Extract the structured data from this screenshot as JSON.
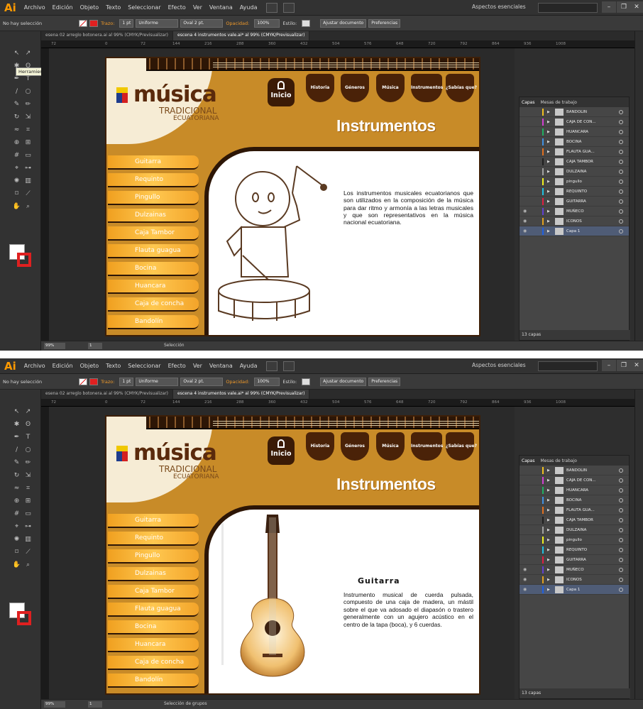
{
  "app": {
    "logo": "Ai",
    "workspace": "Aspectos esenciales"
  },
  "menu": [
    "Archivo",
    "Edición",
    "Objeto",
    "Texto",
    "Seleccionar",
    "Efecto",
    "Ver",
    "Ventana",
    "Ayuda"
  ],
  "control_bar": {
    "selection_state": "No hay selección",
    "stroke_label": "Trazo:",
    "stroke_weight": "1 pt",
    "profile": "Uniforme",
    "brush": "Oval 2 pt.",
    "opacity_label": "Opacidad:",
    "opacity_value": "100%",
    "style_label": "Estilo:",
    "fit_doc": "Ajustar documento",
    "prefs": "Preferencias"
  },
  "doc_tabs": [
    {
      "label": "esena 02 arreglo botonera.ai al 99% (CMYK/Previsualizar)"
    },
    {
      "label": "escena 4 instrumentos vale.ai* al 99% (CMYK/Previsualizar)"
    }
  ],
  "ruler_ticks": [
    "72",
    "0",
    "72",
    "144",
    "216",
    "288",
    "360",
    "432",
    "504",
    "576",
    "648",
    "720",
    "792",
    "864",
    "936",
    "1008",
    "1080"
  ],
  "tooltip": "Herramienta Selección (V)",
  "artboard": {
    "logo_main": "música",
    "logo_sub1": "TRADICIONAL",
    "logo_sub2": "ECUATORIANA",
    "home_label": "Inicio",
    "nav": [
      "Historia",
      "Géneros",
      "Música",
      "Instrumentos",
      "¿Sabías que?"
    ],
    "section_title": "Instrumentos",
    "sidebar": [
      "Guitarra",
      "Requinto",
      "Pingullo",
      "Dulzainas",
      "Caja Tambor",
      "Flauta guagua",
      "Bocina",
      "Huancara",
      "Caja de concha",
      "Bandolín"
    ]
  },
  "screen1": {
    "body": "Los instrumentos musicales ecuatorianos que son utilizados en la composición de la música para dar ritmo y armonía a las letras musicales y que son representativos en la música nacional ecuatoriana.",
    "zoom": "99%",
    "page": "1",
    "status": "Selección"
  },
  "screen2": {
    "heading": "Guitarra",
    "body": "Instrumento musical de cuerda pulsada, compuesto de una caja de madera, un mástil sobre el que va adosado el diapasón o trastero generalmente con un agujero acústico en el centro de la tapa (boca), y 6 cuerdas.",
    "zoom": "99%",
    "page": "1",
    "status": "Selección de grupos"
  },
  "layers_panel": {
    "tabs": [
      "Capas",
      "Mesas de trabajo"
    ],
    "count": "13 capas",
    "layers": [
      {
        "name": "BANDOLIN",
        "color": "#f0c020",
        "eye": false
      },
      {
        "name": "CAJA DE CON...",
        "color": "#d040d0",
        "eye": false
      },
      {
        "name": "HUANCARA",
        "color": "#20b060",
        "eye": false
      },
      {
        "name": "BOCINA",
        "color": "#4090e0",
        "eye": false
      },
      {
        "name": "FLAUTA GUA...",
        "color": "#e07020",
        "eye": false
      },
      {
        "name": "CAJA TAMBOR",
        "color": "#202020",
        "eye": false
      },
      {
        "name": "DULZAINA",
        "color": "#a0a0a0",
        "eye": false
      },
      {
        "name": "pingullo",
        "color": "#f0f020",
        "eye": false
      },
      {
        "name": "REQUINTO",
        "color": "#20c0e0",
        "eye": false
      },
      {
        "name": "GUITARRA",
        "color": "#e02040",
        "eye": false
      },
      {
        "name": "MUÑECO",
        "color": "#6040d0",
        "eye": true
      },
      {
        "name": "ICONOS",
        "color": "#e0a020",
        "eye": true
      },
      {
        "name": "Capa 1",
        "color": "#2060e0",
        "eye": true
      }
    ]
  },
  "colors": {
    "accent": "#ff9a00",
    "artboard": "#c88b28",
    "brown": "#2d1606",
    "selected_row": "#4f5c76"
  }
}
